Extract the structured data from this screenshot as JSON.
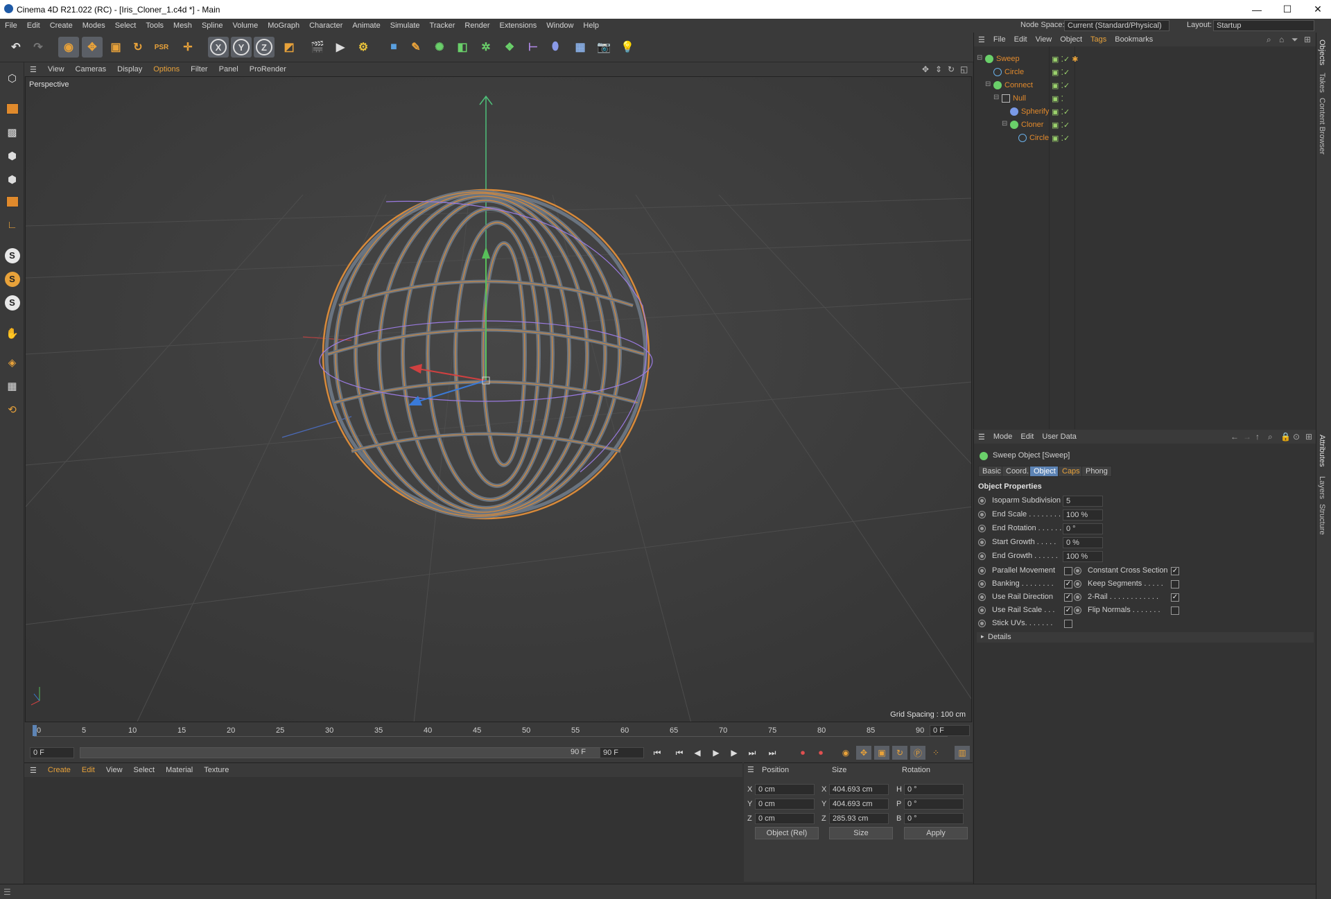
{
  "window": {
    "title": "Cinema 4D R21.022 (RC) - [Iris_Cloner_1.c4d *] - Main"
  },
  "menubar": {
    "items": [
      "File",
      "Edit",
      "Create",
      "Modes",
      "Select",
      "Tools",
      "Mesh",
      "Spline",
      "Volume",
      "MoGraph",
      "Character",
      "Animate",
      "Simulate",
      "Tracker",
      "Render",
      "Extensions",
      "Window",
      "Help"
    ],
    "node_space_label": "Node Space:",
    "node_space_value": "Current (Standard/Physical)",
    "layout_label": "Layout:",
    "layout_value": "Startup"
  },
  "toolbar": {
    "axis_x": "X",
    "axis_y": "Y",
    "axis_z": "Z"
  },
  "viewport": {
    "menu": [
      "View",
      "Cameras",
      "Display",
      "Options",
      "Filter",
      "Panel",
      "ProRender"
    ],
    "camera_label": "Perspective",
    "grid_spacing": "Grid Spacing : 100 cm"
  },
  "timeline": {
    "ticks": [
      "0",
      "5",
      "10",
      "15",
      "20",
      "25",
      "30",
      "35",
      "40",
      "45",
      "50",
      "55",
      "60",
      "65",
      "70",
      "75",
      "80",
      "85",
      "90"
    ],
    "current_frame": "0 F",
    "start_frame": "0 F",
    "range_start": "0 F",
    "range_end": "90 F",
    "end_frame": "90 F"
  },
  "material_manager": {
    "menu": [
      "Create",
      "Edit",
      "View",
      "Select",
      "Material",
      "Texture"
    ]
  },
  "coord_manager": {
    "headers": {
      "position": "Position",
      "size": "Size",
      "rotation": "Rotation"
    },
    "rows": [
      {
        "axis": "X",
        "pos": "0 cm",
        "size_axis": "X",
        "size": "404.693 cm",
        "rot_axis": "H",
        "rot": "0 °"
      },
      {
        "axis": "Y",
        "pos": "0 cm",
        "size_axis": "Y",
        "size": "404.693 cm",
        "rot_axis": "P",
        "rot": "0 °"
      },
      {
        "axis": "Z",
        "pos": "0 cm",
        "size_axis": "Z",
        "size": "285.93 cm",
        "rot_axis": "B",
        "rot": "0 °"
      }
    ],
    "mode_select": "Object (Rel)",
    "size_select": "Size",
    "apply": "Apply"
  },
  "object_manager": {
    "menu": [
      "File",
      "Edit",
      "View",
      "Object",
      "Tags",
      "Bookmarks"
    ],
    "objects": [
      {
        "name": "Sweep",
        "icon": "sweep-icon",
        "color": "#e28a2c"
      },
      {
        "name": "Circle",
        "icon": "circle-icon",
        "color": "#e28a2c"
      },
      {
        "name": "Connect",
        "icon": "connect-icon",
        "color": "#e28a2c"
      },
      {
        "name": "Null",
        "icon": "null-icon",
        "color": "#e28a2c"
      },
      {
        "name": "Spherify",
        "icon": "spherify-icon",
        "color": "#e28a2c"
      },
      {
        "name": "Cloner",
        "icon": "cloner-icon",
        "color": "#e28a2c"
      },
      {
        "name": "Circle",
        "icon": "circle-icon",
        "color": "#e28a2c"
      }
    ]
  },
  "attribute_manager": {
    "menu": [
      "Mode",
      "Edit",
      "User Data"
    ],
    "object_title": "Sweep Object [Sweep]",
    "tabs": [
      "Basic",
      "Coord.",
      "Object",
      "Caps",
      "Phong"
    ],
    "active_tab": "Object",
    "section": "Object Properties",
    "fields": [
      {
        "label": "Isoparm Subdivision",
        "value": "5"
      },
      {
        "label": "End Scale . . . . . . . .",
        "value": "100 %"
      },
      {
        "label": "End Rotation . . . . . .",
        "value": "0 °"
      },
      {
        "label": "Start Growth . . . . .",
        "value": "0 %"
      },
      {
        "label": "End Growth . . . . . .",
        "value": "100 %"
      }
    ],
    "checks_left": [
      {
        "label": "Parallel Movement",
        "checked": false
      },
      {
        "label": "Banking . . . . . . . .",
        "checked": true
      },
      {
        "label": "Use Rail Direction",
        "checked": true
      },
      {
        "label": "Use Rail Scale . . .",
        "checked": true
      },
      {
        "label": "Stick UVs. . . . . . .",
        "checked": false
      }
    ],
    "checks_right": [
      {
        "label": "Constant Cross Section",
        "checked": true
      },
      {
        "label": "Keep Segments . . . . .",
        "checked": false
      },
      {
        "label": "2-Rail . . . . . . . . . . . .",
        "checked": true
      },
      {
        "label": "Flip Normals . . . . . . .",
        "checked": false
      }
    ],
    "details": "Details"
  },
  "side_tabs": [
    "Objects",
    "Takes",
    "Content Browser",
    "Attributes",
    "Layers",
    "Structure"
  ],
  "colors": {
    "accent": "#e28a2c",
    "active_tab": "#5d84b5",
    "check_green": "#9cd36d"
  }
}
